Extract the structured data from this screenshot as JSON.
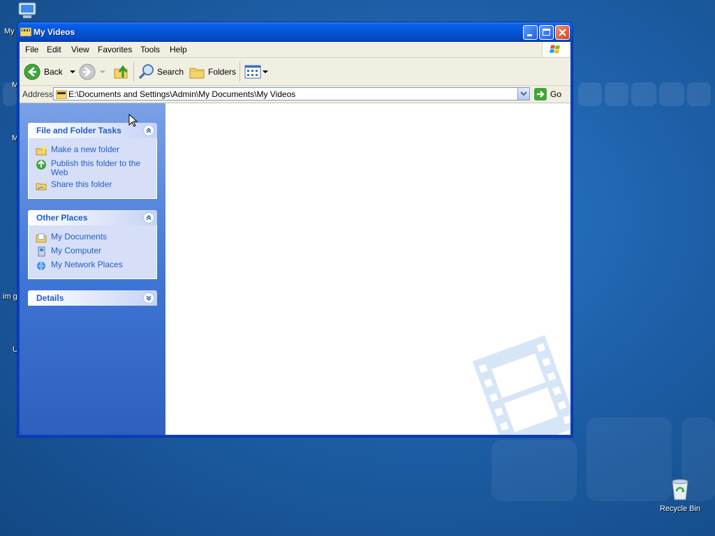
{
  "desktop": {
    "icons": [
      {
        "label": "Recycle Bin",
        "icon": "recycle-bin-icon"
      }
    ],
    "partial_labels": [
      "My",
      "M",
      "im g",
      "U"
    ]
  },
  "window": {
    "title": "My Videos",
    "title_icon": "my-videos-folder-icon",
    "controls": [
      "minimize-icon",
      "maximize-icon",
      "close-icon"
    ]
  },
  "menubar": {
    "items": [
      "File",
      "Edit",
      "View",
      "Favorites",
      "Tools",
      "Help"
    ]
  },
  "toolbar": {
    "back_label": "Back",
    "search_label": "Search",
    "folders_label": "Folders"
  },
  "address": {
    "label": "Address",
    "value": "E:\\Documents and Settings\\Admin\\My Documents\\My Videos",
    "go_label": "Go"
  },
  "task_pane": {
    "file_folder_tasks": {
      "title": "File and Folder Tasks",
      "items": [
        "Make a new folder",
        "Publish this folder to the Web",
        "Share this folder"
      ]
    },
    "other_places": {
      "title": "Other Places",
      "items": [
        "My Documents",
        "My Computer",
        "My Network Places"
      ]
    },
    "details": {
      "title": "Details"
    }
  },
  "colors": {
    "titlebar": "#0454d6",
    "task_link": "#215dc6",
    "task_pane": "#6490e0",
    "desktop": "#1d5fa8"
  }
}
